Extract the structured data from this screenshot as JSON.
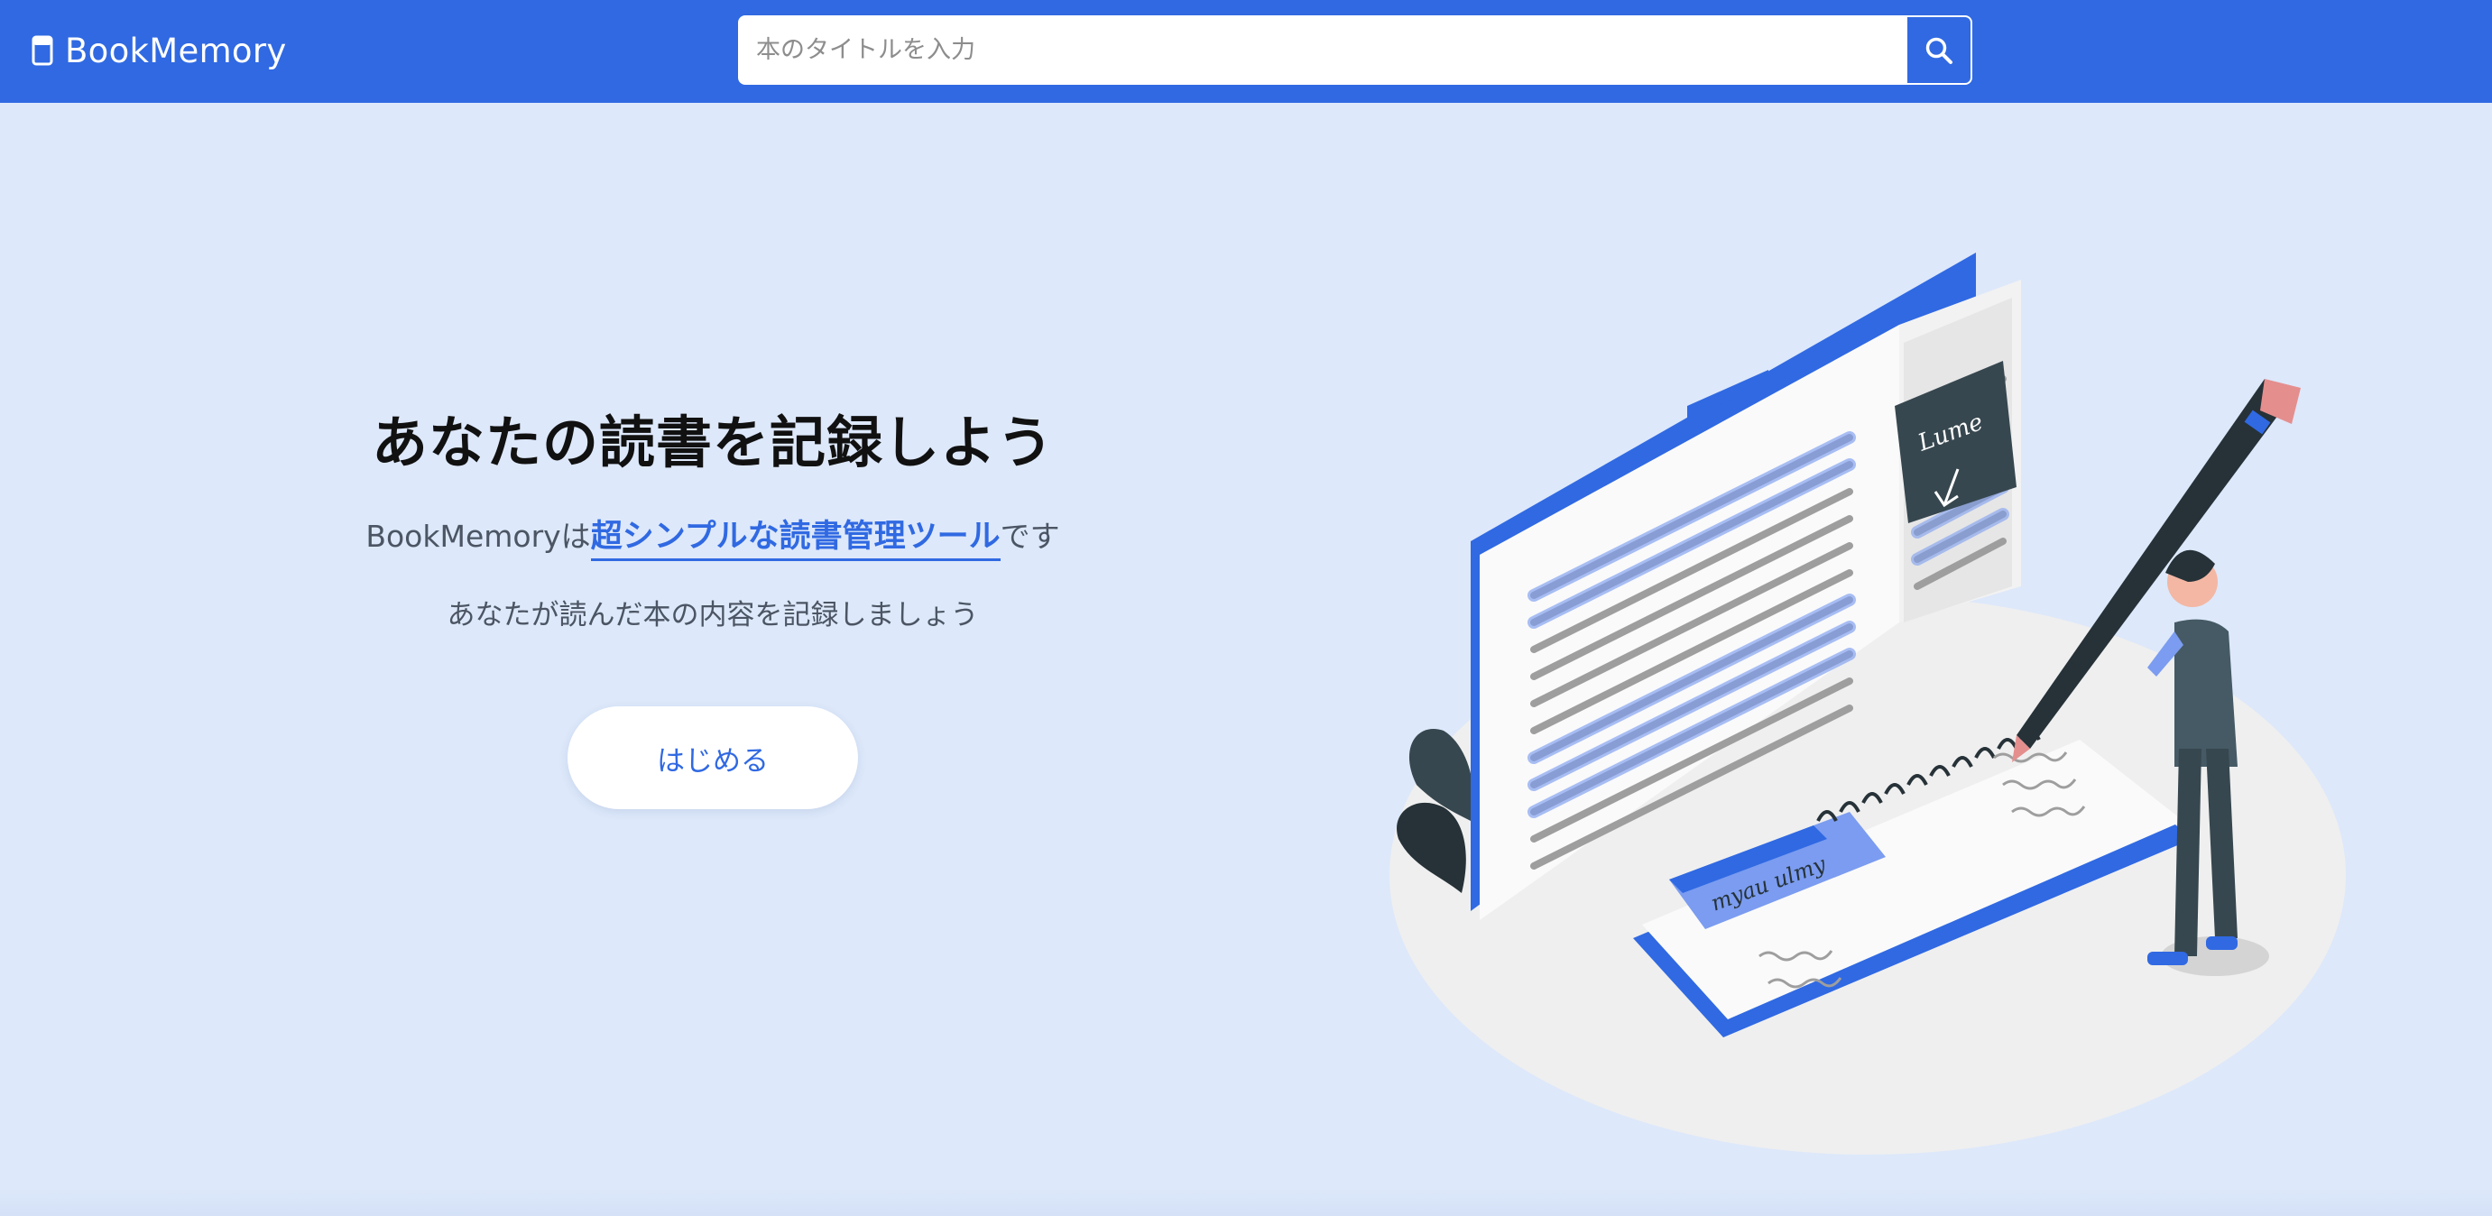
{
  "navbar": {
    "brand": "BookMemory",
    "brand_icon": "book-icon",
    "search": {
      "placeholder": "本のタイトルを入力",
      "value": "",
      "button_icon": "search-icon"
    }
  },
  "hero": {
    "title": "あなたの読書を記録しよう",
    "subtitle_prefix": "BookMemoryは",
    "subtitle_highlight": "超シンプルな読書管理ツール",
    "subtitle_suffix": "です",
    "description": "あなたが読んだ本の内容を記録しましょう",
    "start_button": "はじめる"
  },
  "illustration": {
    "note_scribble": "Lume",
    "sticky_scribble": "myau ulmy"
  },
  "colors": {
    "primary": "#3069e2",
    "background": "#dde8fa",
    "title": "#111111",
    "muted_text": "#4b5563"
  }
}
